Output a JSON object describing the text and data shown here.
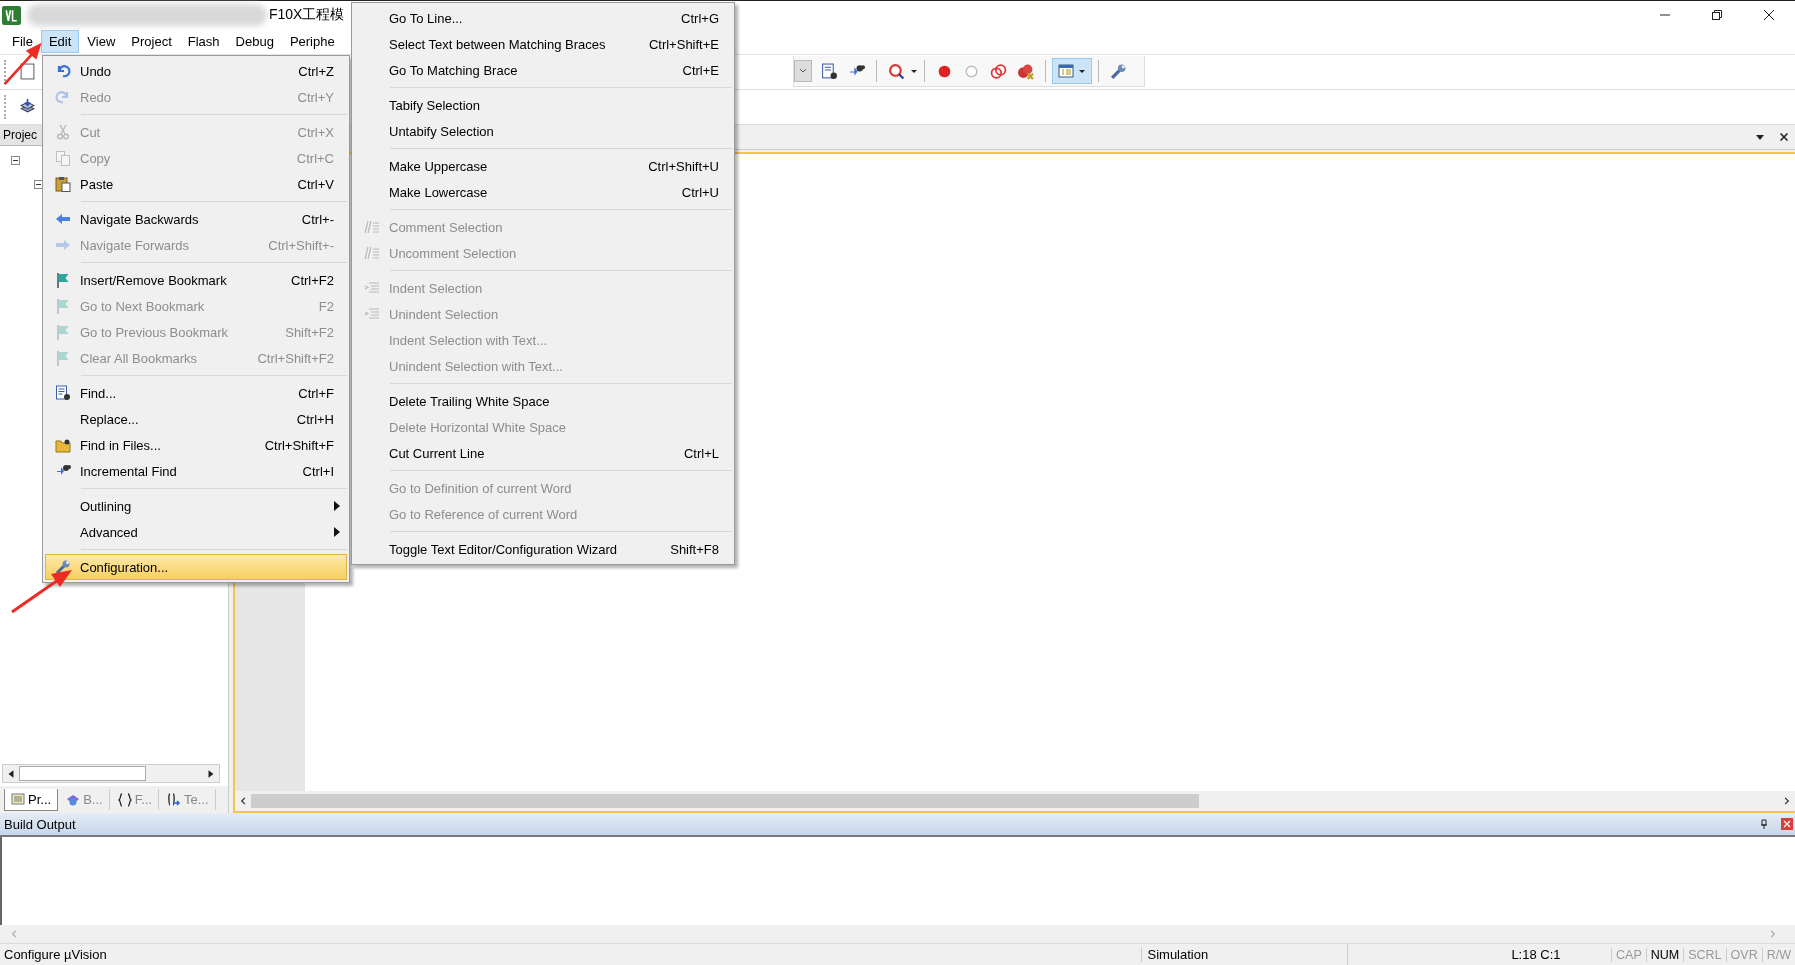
{
  "window": {
    "title": "F10X工程模"
  },
  "menu_bar": [
    {
      "label": "File",
      "selected": false
    },
    {
      "label": "Edit",
      "selected": true
    },
    {
      "label": "View",
      "selected": false
    },
    {
      "label": "Project",
      "selected": false
    },
    {
      "label": "Flash",
      "selected": false
    },
    {
      "label": "Debug",
      "selected": false
    },
    {
      "label": "Periphe",
      "selected": false
    }
  ],
  "project_panel": {
    "title": "Projec",
    "tabs": [
      {
        "label": "Pr...",
        "selected": true
      },
      {
        "label": "B...",
        "selected": false
      },
      {
        "label": "F...",
        "selected": false
      },
      {
        "label": "Te...",
        "selected": false
      }
    ]
  },
  "edit_menu": [
    {
      "kind": "item",
      "label": "Undo",
      "shortcut": "Ctrl+Z",
      "disabled": false,
      "selected": false
    },
    {
      "kind": "item",
      "label": "Redo",
      "shortcut": "Ctrl+Y",
      "disabled": true,
      "selected": false
    },
    {
      "kind": "separator"
    },
    {
      "kind": "item",
      "label": "Cut",
      "shortcut": "Ctrl+X",
      "disabled": true,
      "selected": false
    },
    {
      "kind": "item",
      "label": "Copy",
      "shortcut": "Ctrl+C",
      "disabled": true,
      "selected": false
    },
    {
      "kind": "item",
      "label": "Paste",
      "shortcut": "Ctrl+V",
      "disabled": false,
      "selected": false
    },
    {
      "kind": "separator"
    },
    {
      "kind": "item",
      "label": "Navigate Backwards",
      "shortcut": "Ctrl+-",
      "disabled": false,
      "selected": false
    },
    {
      "kind": "item",
      "label": "Navigate Forwards",
      "shortcut": "Ctrl+Shift+-",
      "disabled": true,
      "selected": false
    },
    {
      "kind": "separator"
    },
    {
      "kind": "item",
      "label": "Insert/Remove Bookmark",
      "shortcut": "Ctrl+F2",
      "disabled": false,
      "selected": false
    },
    {
      "kind": "item",
      "label": "Go to Next Bookmark",
      "shortcut": "F2",
      "disabled": true,
      "selected": false
    },
    {
      "kind": "item",
      "label": "Go to Previous Bookmark",
      "shortcut": "Shift+F2",
      "disabled": true,
      "selected": false
    },
    {
      "kind": "item",
      "label": "Clear All Bookmarks",
      "shortcut": "Ctrl+Shift+F2",
      "disabled": true,
      "selected": false
    },
    {
      "kind": "separator"
    },
    {
      "kind": "item",
      "label": "Find...",
      "shortcut": "Ctrl+F",
      "disabled": false,
      "selected": false
    },
    {
      "kind": "item",
      "label": "Replace...",
      "shortcut": "Ctrl+H",
      "disabled": false,
      "selected": false
    },
    {
      "kind": "item",
      "label": "Find in Files...",
      "shortcut": "Ctrl+Shift+F",
      "disabled": false,
      "selected": false
    },
    {
      "kind": "item",
      "label": "Incremental Find",
      "shortcut": "Ctrl+I",
      "disabled": false,
      "selected": false
    },
    {
      "kind": "separator"
    },
    {
      "kind": "submenu",
      "label": "Outlining",
      "disabled": false,
      "selected": false
    },
    {
      "kind": "submenu",
      "label": "Advanced",
      "disabled": false,
      "selected": false
    },
    {
      "kind": "separator"
    },
    {
      "kind": "item",
      "label": "Configuration...",
      "disabled": false,
      "selected": true
    }
  ],
  "advanced_menu": [
    {
      "kind": "item",
      "label": "Go To Line...",
      "shortcut": "Ctrl+G",
      "disabled": false
    },
    {
      "kind": "item",
      "label": "Select Text between Matching Braces",
      "shortcut": "Ctrl+Shift+E",
      "disabled": false
    },
    {
      "kind": "item",
      "label": "Go To Matching Brace",
      "shortcut": "Ctrl+E",
      "disabled": false
    },
    {
      "kind": "separator"
    },
    {
      "kind": "item",
      "label": "Tabify Selection",
      "disabled": false
    },
    {
      "kind": "item",
      "label": "Untabify Selection",
      "disabled": false
    },
    {
      "kind": "separator"
    },
    {
      "kind": "item",
      "label": "Make Uppercase",
      "shortcut": "Ctrl+Shift+U",
      "disabled": false
    },
    {
      "kind": "item",
      "label": "Make Lowercase",
      "shortcut": "Ctrl+U",
      "disabled": false
    },
    {
      "kind": "separator"
    },
    {
      "kind": "item",
      "label": "Comment Selection",
      "disabled": true
    },
    {
      "kind": "item",
      "label": "Uncomment Selection",
      "disabled": true
    },
    {
      "kind": "separator"
    },
    {
      "kind": "item",
      "label": "Indent Selection",
      "disabled": true
    },
    {
      "kind": "item",
      "label": "Unindent Selection",
      "disabled": true
    },
    {
      "kind": "item",
      "label": "Indent Selection with Text...",
      "disabled": true
    },
    {
      "kind": "item",
      "label": "Unindent Selection with Text...",
      "disabled": true
    },
    {
      "kind": "separator"
    },
    {
      "kind": "item",
      "label": "Delete Trailing White Space",
      "disabled": false
    },
    {
      "kind": "item",
      "label": "Delete Horizontal White Space",
      "disabled": true
    },
    {
      "kind": "item",
      "label": "Cut Current Line",
      "shortcut": "Ctrl+L",
      "disabled": false
    },
    {
      "kind": "separator"
    },
    {
      "kind": "item",
      "label": "Go to Definition of current Word",
      "disabled": true
    },
    {
      "kind": "item",
      "label": "Go to Reference of current Word",
      "disabled": true
    },
    {
      "kind": "separator"
    },
    {
      "kind": "item",
      "label": "Toggle Text Editor/Configuration Wizard",
      "shortcut": "Shift+F8",
      "disabled": false
    }
  ],
  "build_output": {
    "title": "Build Output"
  },
  "status_bar": {
    "message": "Configure µVision",
    "mode": "Simulation",
    "position": "L:18 C:1",
    "indicators": [
      {
        "label": "CAP",
        "on": false
      },
      {
        "label": "NUM",
        "on": true
      },
      {
        "label": "SCRL",
        "on": false
      },
      {
        "label": "OVR",
        "on": false
      },
      {
        "label": "R/W",
        "on": false
      }
    ]
  }
}
